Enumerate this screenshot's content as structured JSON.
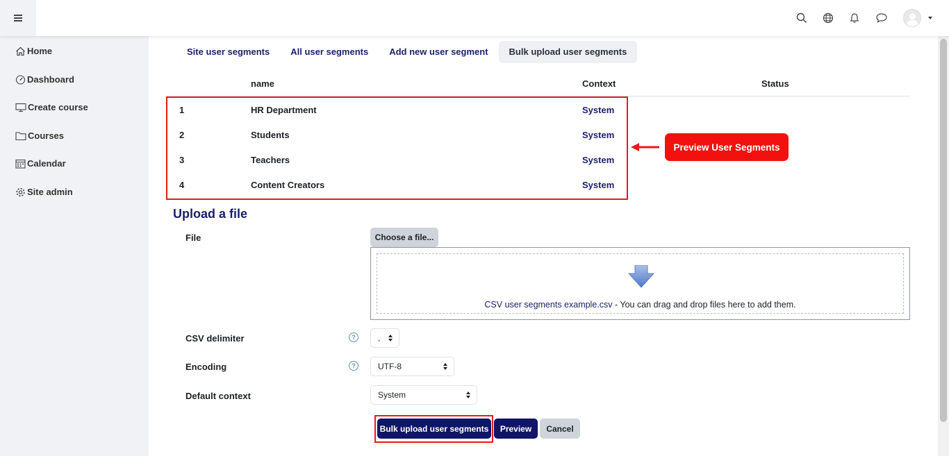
{
  "sidebar": {
    "items": [
      {
        "label": "Home",
        "icon": "home-icon"
      },
      {
        "label": "Dashboard",
        "icon": "dashboard-icon"
      },
      {
        "label": "Create course",
        "icon": "monitor-icon"
      },
      {
        "label": "Courses",
        "icon": "folder-icon"
      },
      {
        "label": "Calendar",
        "icon": "calendar-icon"
      },
      {
        "label": "Site admin",
        "icon": "gear-icon"
      }
    ]
  },
  "tabs": [
    {
      "label": "Site user segments",
      "active": false
    },
    {
      "label": "All user segments",
      "active": false
    },
    {
      "label": "Add new user segment",
      "active": false
    },
    {
      "label": "Bulk upload user segments",
      "active": true
    }
  ],
  "table": {
    "headers": {
      "name": "name",
      "context": "Context",
      "status": "Status"
    },
    "rows": [
      {
        "num": "1",
        "name": "HR Department",
        "context": "System"
      },
      {
        "num": "2",
        "name": "Students",
        "context": "System"
      },
      {
        "num": "3",
        "name": "Teachers",
        "context": "System"
      },
      {
        "num": "4",
        "name": "Content Creators",
        "context": "System"
      }
    ]
  },
  "callout": {
    "text": "Preview User Segments",
    "color": "#f2110f"
  },
  "form": {
    "title": "Upload a file",
    "file_label": "File",
    "choose_button": "Choose a file...",
    "dropzone_file": "CSV user segments example.csv",
    "dropzone_text": " - You can drag and drop files here to add them.",
    "csv_delimiter_label": "CSV delimiter",
    "csv_delimiter_value": ",",
    "encoding_label": "Encoding",
    "encoding_value": "UTF-8",
    "default_context_label": "Default context",
    "default_context_value": "System",
    "help_icon": "?"
  },
  "buttons": {
    "bulk_upload": "Bulk upload user segments",
    "preview": "Preview",
    "cancel": "Cancel"
  },
  "colors": {
    "primary": "#101567",
    "accent_link": "#1a1f6b",
    "annotation": "#e8191c"
  }
}
